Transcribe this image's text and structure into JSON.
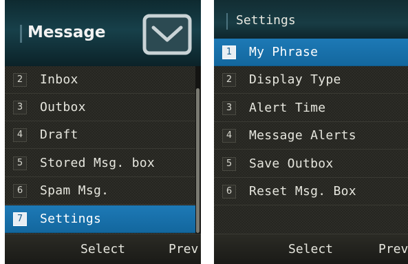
{
  "left_screen": {
    "title": "Message",
    "header_icon": "envelope-icon",
    "menu": [
      {
        "num": "2",
        "label": "Inbox",
        "selected": false
      },
      {
        "num": "3",
        "label": "Outbox",
        "selected": false
      },
      {
        "num": "4",
        "label": "Draft",
        "selected": false
      },
      {
        "num": "5",
        "label": "Stored Msg. box",
        "selected": false
      },
      {
        "num": "6",
        "label": "Spam Msg.",
        "selected": false
      },
      {
        "num": "7",
        "label": "Settings",
        "selected": true
      }
    ],
    "softkeys": {
      "center": "Select",
      "right": "Prev"
    }
  },
  "right_screen": {
    "title": "Settings",
    "menu": [
      {
        "num": "1",
        "label": "My Phrase",
        "selected": true
      },
      {
        "num": "2",
        "label": "Display Type",
        "selected": false
      },
      {
        "num": "3",
        "label": "Alert Time",
        "selected": false
      },
      {
        "num": "4",
        "label": "Message Alerts",
        "selected": false
      },
      {
        "num": "5",
        "label": "Save Outbox",
        "selected": false
      },
      {
        "num": "6",
        "label": "Reset Msg. Box",
        "selected": false
      }
    ],
    "softkeys": {
      "center": "Select",
      "right": "Prev"
    }
  },
  "colors": {
    "selection": "#1d79b6",
    "header": "#17404a",
    "list_background": "#252520",
    "text": "#e6e6de"
  }
}
